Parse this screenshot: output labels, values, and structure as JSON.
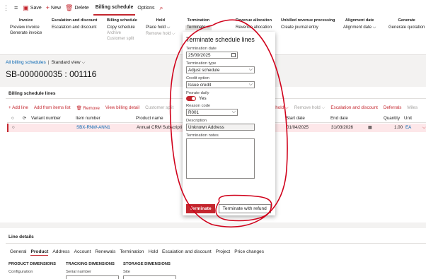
{
  "toolbar": {
    "save": "Save",
    "new": "New",
    "delete": "Delete",
    "tabs": [
      "Billing schedule",
      "Options"
    ]
  },
  "ribbon": {
    "invoice": {
      "title": "Invoice",
      "items": [
        "Preview invoice",
        "Generate invoice"
      ]
    },
    "escalation": {
      "title": "Escalation and discount",
      "items": [
        "Escalation and discount"
      ]
    },
    "billing": {
      "title": "Billing schedule",
      "items": [
        "Copy schedule",
        "Archive",
        "Customer split"
      ]
    },
    "hold": {
      "title": "Hold",
      "items": [
        "Place hold",
        "Remove hold"
      ]
    },
    "termination": {
      "title": "Termination",
      "items": [
        "Terminate"
      ]
    },
    "revenue": {
      "title": "Revenue allocation",
      "items": [
        "Revenue allocation"
      ]
    },
    "unbilled": {
      "title": "Unbilled revenue processing",
      "items": [
        "Create journal entry"
      ]
    },
    "alignment": {
      "title": "Alignment date",
      "items": [
        "Alignment date"
      ]
    },
    "generate": {
      "title": "Generate",
      "items": [
        "Generate quotation"
      ]
    }
  },
  "breadcrumb": {
    "link": "All billing schedules",
    "sep": "|",
    "view": "Standard view"
  },
  "record_title": "SB-000000035 : 001116",
  "lines": {
    "title": "Billing schedule lines",
    "actions": [
      "Add line",
      "Add from items list",
      "Remove",
      "View billing detail",
      "Customer split"
    ],
    "actions_right": [
      "e hold",
      "Remove hold",
      "Escalation and discount",
      "Deferrals",
      "Miles"
    ],
    "columns": [
      "Variant number",
      "Item number",
      "Product name",
      "Start date",
      "End date",
      "Quantity",
      "Unit"
    ],
    "row": {
      "item": "SBX-RNW-ANN1",
      "product": "Annual CRM Subscripti",
      "start": "01/04/2025",
      "end": "31/03/2026",
      "qty": "1.00",
      "unit": "EA"
    }
  },
  "line_details": {
    "title": "Line details",
    "tabs": [
      "General",
      "Product",
      "Address",
      "Account",
      "Renewals",
      "Termination",
      "Hold",
      "Escalation and discount",
      "Project",
      "Price changes"
    ],
    "groups": [
      {
        "header": "PRODUCT DIMENSIONS",
        "label": "Configuration"
      },
      {
        "header": "TRACKING DIMENSIONS",
        "label": "Serial number"
      },
      {
        "header": "STORAGE DIMENSIONS",
        "label": "Site"
      }
    ]
  },
  "dialog": {
    "title": "Terminate schedule lines",
    "termination_date_label": "Termination date",
    "termination_date": "25/09/2025",
    "termination_type_label": "Termination type",
    "termination_type": "Adjust schedule",
    "credit_option_label": "Credit option",
    "credit_option": "Issue credit",
    "prorate_label": "Prorate daily",
    "prorate_value": "Yes",
    "reason_label": "Reason code",
    "reason": "R001",
    "description_label": "Description",
    "description": "Unknown Address",
    "notes_label": "Termination notes",
    "btn_terminate": "Terminate",
    "btn_refund": "Terminate with refund"
  },
  "colors": {
    "accent": "#c4262e",
    "link": "#0063b1",
    "annotation": "#d0021b"
  }
}
